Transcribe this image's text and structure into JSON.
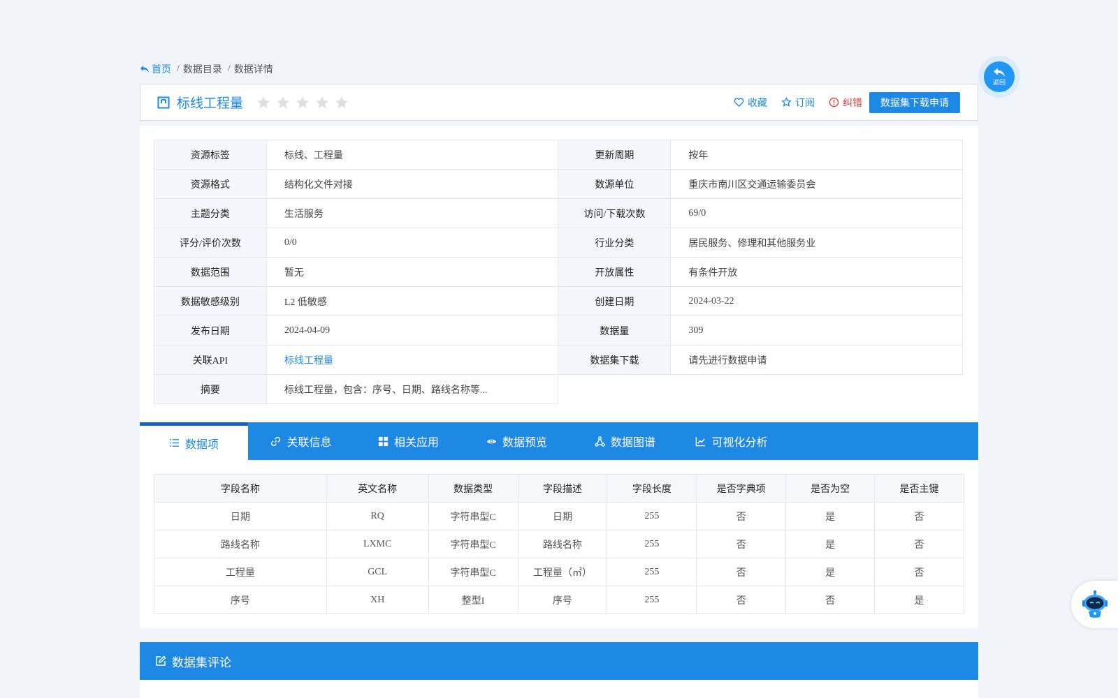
{
  "breadcrumb": {
    "home": "首页",
    "catalog": "数据目录",
    "detail": "数据详情",
    "separator": "/"
  },
  "dataset": {
    "title": "标线工程量",
    "rating": {
      "value": 0,
      "max": 5
    },
    "actions": {
      "favorite": "收藏",
      "subscribe": "订阅",
      "report_error": "纠错",
      "apply": "数据集下载申请"
    }
  },
  "info": {
    "rows": [
      {
        "l1": "资源标签",
        "v1": "标线、工程量",
        "l2": "更新周期",
        "v2": "按年"
      },
      {
        "l1": "资源格式",
        "v1": "结构化文件对接",
        "l2": "数源单位",
        "v2": "重庆市南川区交通运输委员会"
      },
      {
        "l1": "主题分类",
        "v1": "生活服务",
        "l2": "访问/下载次数",
        "v2": "69/0"
      },
      {
        "l1": "评分/评价次数",
        "v1": "0/0",
        "l2": "行业分类",
        "v2": "居民服务、修理和其他服务业"
      },
      {
        "l1": "数据范围",
        "v1": "暂无",
        "l2": "开放属性",
        "v2": "有条件开放"
      },
      {
        "l1": "数据敏感级别",
        "v1": "L2 低敏感",
        "l2": "创建日期",
        "v2": "2024-03-22"
      },
      {
        "l1": "发布日期",
        "v1": "2024-04-09",
        "l2": "数据量",
        "v2": "309"
      },
      {
        "l1": "关联API",
        "v1": "标线工程量",
        "l2": "数据集下载",
        "v2": "请先进行数据申请"
      },
      {
        "l1": "摘要",
        "v1": "标线工程量，包含：序号、日期、路线名称等..."
      }
    ]
  },
  "tabs": [
    {
      "label": "数据项",
      "icon": "list-icon"
    },
    {
      "label": "关联信息",
      "icon": "link-icon"
    },
    {
      "label": "相关应用",
      "icon": "grid-icon"
    },
    {
      "label": "数据预览",
      "icon": "eye-icon"
    },
    {
      "label": "数据图谱",
      "icon": "graph-icon"
    },
    {
      "label": "可视化分析",
      "icon": "line-chart-icon"
    }
  ],
  "fields": {
    "headers": [
      "字段名称",
      "英文名称",
      "数据类型",
      "字段描述",
      "字段长度",
      "是否字典项",
      "是否为空",
      "是否主键"
    ],
    "rows": [
      [
        "日期",
        "RQ",
        "字符串型C",
        "日期",
        "255",
        "否",
        "是",
        "否"
      ],
      [
        "路线名称",
        "LXMC",
        "字符串型C",
        "路线名称",
        "255",
        "否",
        "是",
        "否"
      ],
      [
        "工程量",
        "GCL",
        "字符串型C",
        "工程量（㎡）",
        "255",
        "否",
        "是",
        "否"
      ],
      [
        "序号",
        "XH",
        "整型I",
        "序号",
        "255",
        "否",
        "否",
        "是"
      ]
    ]
  },
  "comments": {
    "title": "数据集评论"
  },
  "back_button": {
    "label": "返回"
  },
  "colors": {
    "primary": "#1e88e5",
    "error": "#e53935",
    "star": "#e0e0e0",
    "background": "#f1f5fa"
  }
}
